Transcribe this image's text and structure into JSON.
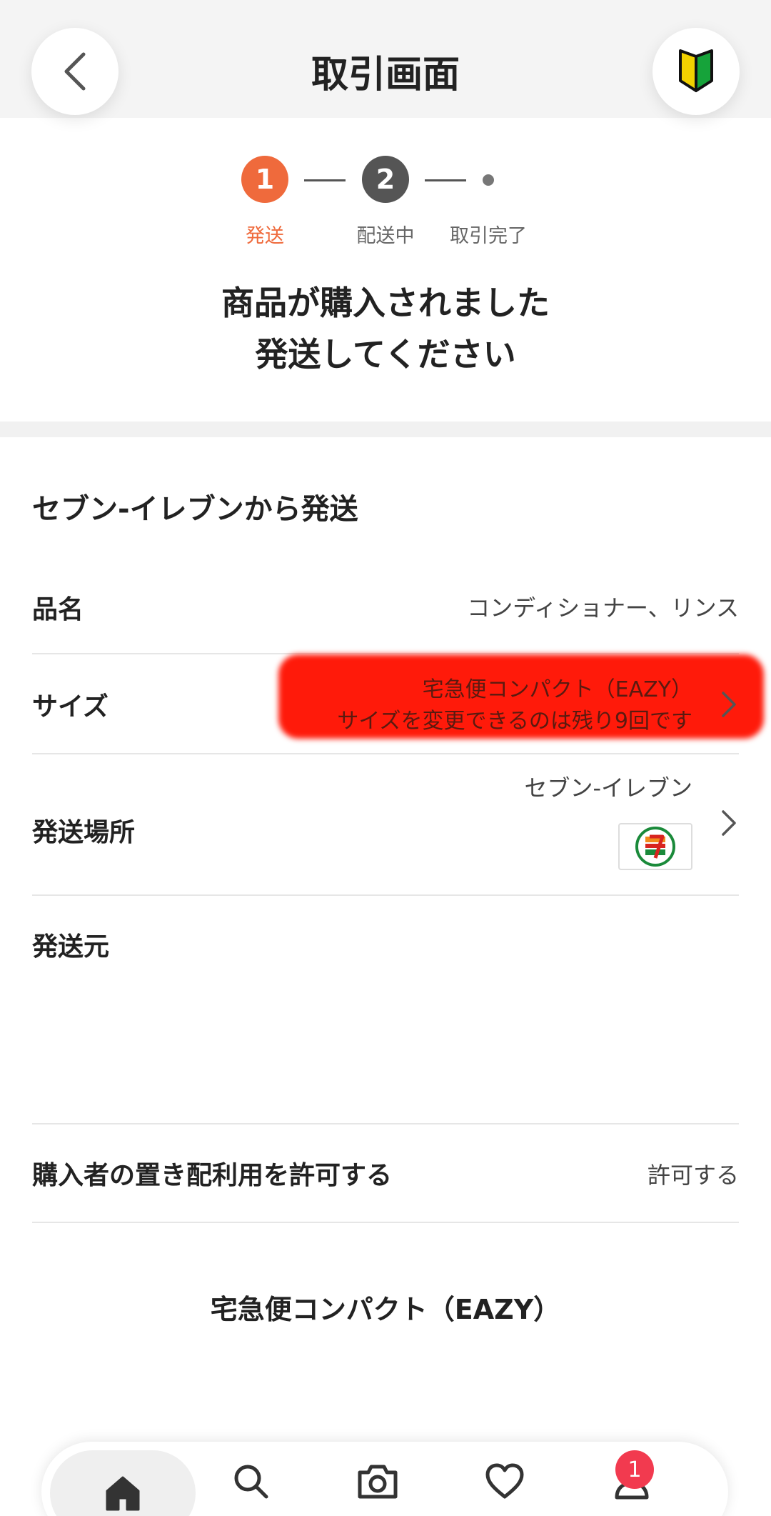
{
  "header": {
    "title": "取引画面",
    "back_icon": "chevron-left-icon",
    "beginner_icon": "beginner-mark-icon"
  },
  "stepper": {
    "steps": [
      {
        "number": "1",
        "label": "発送",
        "state": "active"
      },
      {
        "number": "2",
        "label": "配送中",
        "state": "pending"
      },
      {
        "number": "",
        "label": "取引完了",
        "state": "pending"
      }
    ],
    "active_color": "#ef6a3c"
  },
  "message": {
    "line1": "商品が購入されました",
    "line2": "発送してください"
  },
  "shipping": {
    "section_title": "セブン-イレブンから発送",
    "item_name_label": "品名",
    "item_name_value": "コンディショナー、リンス",
    "size_label": "サイズ",
    "size_value": "宅急便コンパクト（EAZY）",
    "size_note": "サイズを変更できるのは残り9回です",
    "place_label": "発送場所",
    "place_value": "セブン-イレブン",
    "place_logo": "seven-eleven-logo",
    "origin_label": "発送元",
    "allow_label": "購入者の置き配利用を許可する",
    "allow_value": "許可する",
    "service_name": "宅急便コンパクト（EAZY）"
  },
  "tabbar": {
    "items": [
      {
        "icon": "home-icon",
        "active": true
      },
      {
        "icon": "search-icon",
        "active": false
      },
      {
        "icon": "camera-icon",
        "active": false
      },
      {
        "icon": "heart-icon",
        "active": false
      },
      {
        "icon": "person-icon",
        "active": false
      }
    ],
    "badge_count": "1",
    "badge_color": "#f23a4f"
  }
}
